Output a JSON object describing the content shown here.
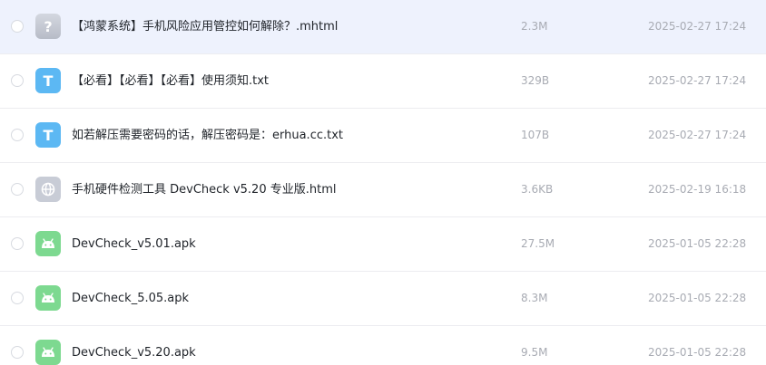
{
  "files": [
    {
      "name": "【鸿蒙系统】手机风险应用管控如何解除？.mhtml",
      "size": "2.3M",
      "date": "2025-02-27 17:24",
      "icon": "unknown-file-icon",
      "glyph": "?"
    },
    {
      "name": "【必看】【必看】【必看】使用须知.txt",
      "size": "329B",
      "date": "2025-02-27 17:24",
      "icon": "text-file-icon",
      "glyph": "T"
    },
    {
      "name": "如若解压需要密码的话，解压密码是：erhua.cc.txt",
      "size": "107B",
      "date": "2025-02-27 17:24",
      "icon": "text-file-icon",
      "glyph": "T"
    },
    {
      "name": "手机硬件检测工具 DevCheck v5.20 专业版.html",
      "size": "3.6KB",
      "date": "2025-02-19 16:18",
      "icon": "web-file-icon"
    },
    {
      "name": "DevCheck_v5.01.apk",
      "size": "27.5M",
      "date": "2025-01-05 22:28",
      "icon": "android-apk-icon"
    },
    {
      "name": "DevCheck_5.05.apk",
      "size": "8.3M",
      "date": "2025-01-05 22:28",
      "icon": "android-apk-icon"
    },
    {
      "name": "DevCheck_v5.20.apk",
      "size": "9.5M",
      "date": "2025-01-05 22:28",
      "icon": "android-apk-icon"
    }
  ],
  "colors": {
    "hover_row": "#eef2fd",
    "text_icon": "#5cb8f3",
    "apk_icon": "#7dd990",
    "meta_text": "#a8abb3"
  }
}
